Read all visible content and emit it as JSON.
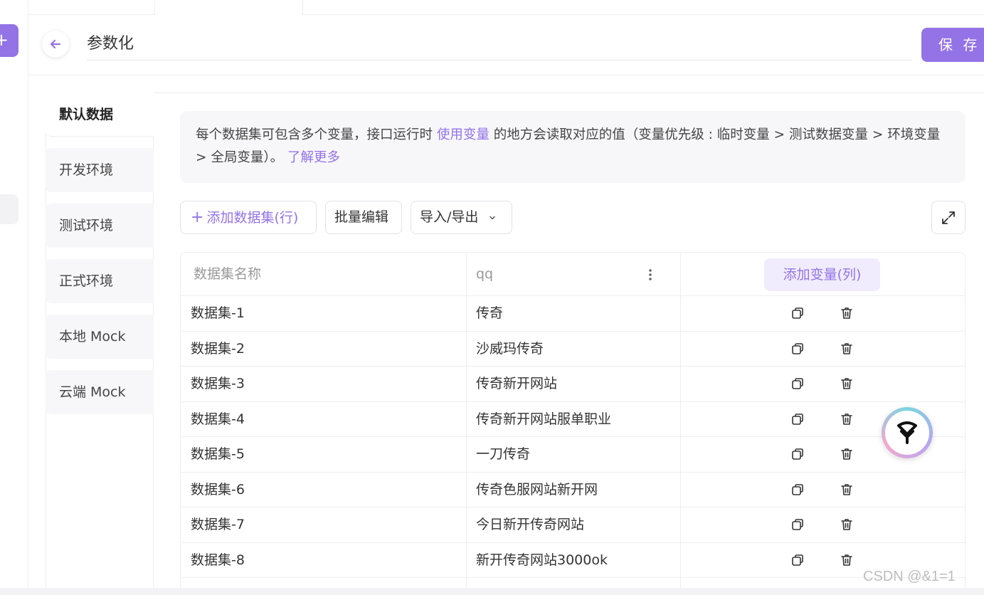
{
  "header": {
    "title": "参数化",
    "save_label": "保 存"
  },
  "env_tabs": [
    {
      "label": "默认数据"
    },
    {
      "label": "开发环境"
    },
    {
      "label": "测试环境"
    },
    {
      "label": "正式环境"
    },
    {
      "label": "本地 Mock"
    },
    {
      "label": "云端 Mock"
    }
  ],
  "info": {
    "text_before": "每个数据集可包含多个变量，接口运行时 ",
    "link1": "使用变量",
    "text_after": " 的地方会读取对应的值（变量优先级 : 临时变量 > 测试数据变量 > 环境变量 > 全局变量）。",
    "link2": "了解更多"
  },
  "toolbar": {
    "add_dataset": "添加数据集(行)",
    "batch_edit": "批量编辑",
    "import_export": "导入/导出"
  },
  "table": {
    "col_name_header": "数据集名称",
    "col_var_header": "qq",
    "add_var_label": "添加变量(列)",
    "rows": [
      {
        "name": "数据集-1",
        "value": "传奇"
      },
      {
        "name": "数据集-2",
        "value": "沙威玛传奇"
      },
      {
        "name": "数据集-3",
        "value": "传奇新开网站"
      },
      {
        "name": "数据集-4",
        "value": "传奇新开网站服单职业"
      },
      {
        "name": "数据集-5",
        "value": "一刀传奇"
      },
      {
        "name": "数据集-6",
        "value": "传奇色服网站新开网"
      },
      {
        "name": "数据集-7",
        "value": "今日新开传奇网站"
      },
      {
        "name": "数据集-8",
        "value": "新开传奇网站3000ok"
      }
    ]
  },
  "watermark": "CSDN @&1=1",
  "colors": {
    "accent": "#9373e6",
    "border": "#eeeef2"
  },
  "icons": [
    "plus-icon",
    "back-arrow-icon",
    "expand-icon",
    "more-vertical-icon",
    "copy-icon",
    "trash-icon",
    "chevron-down-icon"
  ]
}
